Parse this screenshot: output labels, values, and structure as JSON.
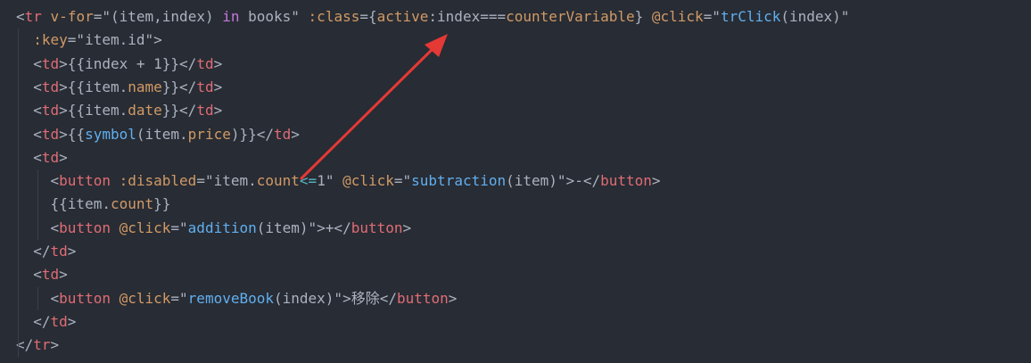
{
  "editor": {
    "background": "#282c34",
    "colors": {
      "punct": "#abb2bf",
      "tag": "#e06c75",
      "attr": "#d19a66",
      "string": "#98c379",
      "method": "#61afef",
      "keyword": "#c678dd",
      "variable": "#e5c07b",
      "operator": "#56b6c2",
      "annotation_arrow": "#e53935"
    },
    "lines": [
      [
        [
          "punct",
          "<"
        ],
        [
          "tag",
          "tr"
        ],
        [
          "punct",
          " "
        ],
        [
          "attr",
          "v-for"
        ],
        [
          "punct",
          "=\""
        ],
        [
          "punct",
          "("
        ],
        [
          "punct",
          "item,index"
        ],
        [
          "punct",
          ") "
        ],
        [
          "keyword",
          "in"
        ],
        [
          "punct",
          " books\" "
        ],
        [
          "attr",
          ":class"
        ],
        [
          "punct",
          "={"
        ],
        [
          "attr",
          "active"
        ],
        [
          "punct",
          ":index==="
        ],
        [
          "attr",
          "counterVariable"
        ],
        [
          "punct",
          "} "
        ],
        [
          "attr",
          "@click"
        ],
        [
          "punct",
          "=\""
        ],
        [
          "method",
          "trClick"
        ],
        [
          "punct",
          "(index)\""
        ]
      ],
      [
        [
          "punct",
          "  "
        ],
        [
          "attr",
          ":key"
        ],
        [
          "punct",
          "=\""
        ],
        [
          "punct",
          "item.id"
        ],
        [
          "punct",
          "\">"
        ]
      ],
      [
        [
          "punct",
          "  <"
        ],
        [
          "tag",
          "td"
        ],
        [
          "punct",
          ">{{"
        ],
        [
          "punct",
          "index + 1"
        ],
        [
          "punct",
          "}}</"
        ],
        [
          "tag",
          "td"
        ],
        [
          "punct",
          ">"
        ]
      ],
      [
        [
          "punct",
          "  <"
        ],
        [
          "tag",
          "td"
        ],
        [
          "punct",
          ">{{"
        ],
        [
          "punct",
          "item."
        ],
        [
          "attr",
          "name"
        ],
        [
          "punct",
          "}}</"
        ],
        [
          "tag",
          "td"
        ],
        [
          "punct",
          ">"
        ]
      ],
      [
        [
          "punct",
          "  <"
        ],
        [
          "tag",
          "td"
        ],
        [
          "punct",
          ">{{"
        ],
        [
          "punct",
          "item."
        ],
        [
          "attr",
          "date"
        ],
        [
          "punct",
          "}}</"
        ],
        [
          "tag",
          "td"
        ],
        [
          "punct",
          ">"
        ]
      ],
      [
        [
          "punct",
          "  <"
        ],
        [
          "tag",
          "td"
        ],
        [
          "punct",
          ">{{"
        ],
        [
          "method",
          "symbol"
        ],
        [
          "punct",
          "(item."
        ],
        [
          "attr",
          "price"
        ],
        [
          "punct",
          ")}}</"
        ],
        [
          "tag",
          "td"
        ],
        [
          "punct",
          ">"
        ]
      ],
      [
        [
          "punct",
          "  <"
        ],
        [
          "tag",
          "td"
        ],
        [
          "punct",
          ">"
        ]
      ],
      [
        [
          "punct",
          "    <"
        ],
        [
          "tag",
          "button"
        ],
        [
          "punct",
          " "
        ],
        [
          "attr",
          ":disabled"
        ],
        [
          "punct",
          "=\""
        ],
        [
          "punct",
          "item."
        ],
        [
          "attr",
          "count"
        ],
        [
          "operator",
          "<="
        ],
        [
          "punct",
          "1\" "
        ],
        [
          "attr",
          "@click"
        ],
        [
          "punct",
          "=\""
        ],
        [
          "method",
          "subtraction"
        ],
        [
          "punct",
          "(item)\">-</"
        ],
        [
          "tag",
          "button"
        ],
        [
          "punct",
          ">"
        ]
      ],
      [
        [
          "punct",
          "    {{"
        ],
        [
          "punct",
          "item."
        ],
        [
          "attr",
          "count"
        ],
        [
          "punct",
          "}}"
        ]
      ],
      [
        [
          "punct",
          "    <"
        ],
        [
          "tag",
          "button"
        ],
        [
          "punct",
          " "
        ],
        [
          "attr",
          "@click"
        ],
        [
          "punct",
          "=\""
        ],
        [
          "method",
          "addition"
        ],
        [
          "punct",
          "(item)\">+</"
        ],
        [
          "tag",
          "button"
        ],
        [
          "punct",
          ">"
        ]
      ],
      [
        [
          "punct",
          "  </"
        ],
        [
          "tag",
          "td"
        ],
        [
          "punct",
          ">"
        ]
      ],
      [
        [
          "punct",
          "  <"
        ],
        [
          "tag",
          "td"
        ],
        [
          "punct",
          ">"
        ]
      ],
      [
        [
          "punct",
          "    <"
        ],
        [
          "tag",
          "button"
        ],
        [
          "punct",
          " "
        ],
        [
          "attr",
          "@click"
        ],
        [
          "punct",
          "=\""
        ],
        [
          "method",
          "removeBook"
        ],
        [
          "punct",
          "(index)\">移除</"
        ],
        [
          "tag",
          "button"
        ],
        [
          "punct",
          ">"
        ]
      ],
      [
        [
          "punct",
          "  </"
        ],
        [
          "tag",
          "td"
        ],
        [
          "punct",
          ">"
        ]
      ],
      [
        [
          "punct",
          "</"
        ],
        [
          "tag",
          "tr"
        ],
        [
          "punct",
          ">"
        ]
      ]
    ]
  }
}
